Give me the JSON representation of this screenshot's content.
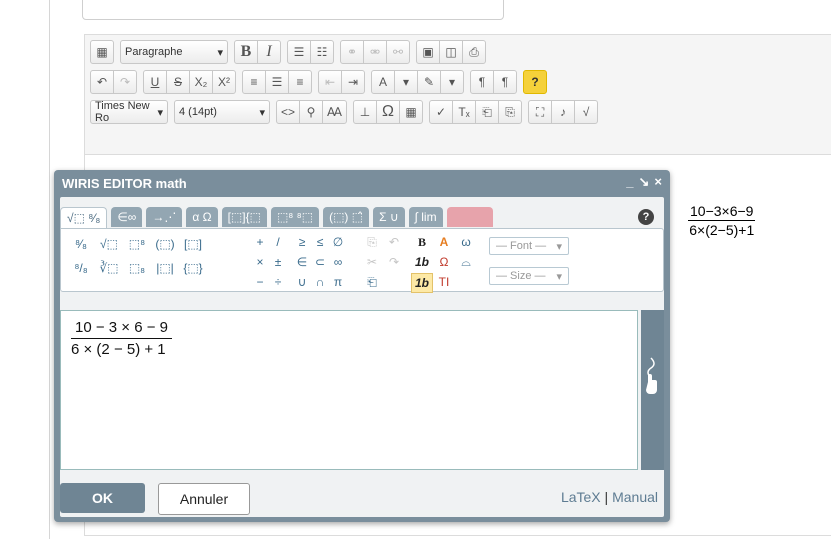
{
  "toolbar": {
    "row1": {
      "format_select": "Paragraphe",
      "bold": "B",
      "italic": "I"
    },
    "row2": {
      "underline": "U",
      "strike": "S",
      "subscript": "X₂",
      "superscript": "X²",
      "help": "?"
    },
    "row3": {
      "font_select": "Times New Ro",
      "size_select": "4 (14pt)",
      "code": "<>",
      "omega": "Ω"
    }
  },
  "preview": {
    "numerator": "10−3×6−9",
    "denominator": "6×(2−5)+1"
  },
  "dialog": {
    "title": "WIRIS EDITOR math",
    "controls": [
      "_",
      "↘",
      "×"
    ],
    "tabs": [
      "√⬚ ⁸⁄₈",
      "∈∞",
      "→⋰",
      "α Ω",
      "[⬚]{⬚",
      "⬚⁸ ⁸⬚",
      "(⬚) ⬚̂",
      "Σ ∪",
      "∫ lim",
      ""
    ],
    "help": "?",
    "palette": {
      "col1": [
        "⁸⁄₈",
        "⁸/₈"
      ],
      "col2": [
        "√⬚",
        "∛⬚"
      ],
      "col3": [
        "⬚⁸",
        "⬚₈"
      ],
      "col4": [
        "(⬚)",
        "|⬚|"
      ],
      "col5": [
        "[⬚]",
        "{⬚}"
      ],
      "ops": [
        "+",
        "/",
        "≥",
        "≤",
        "∅",
        "×",
        "±",
        "∈",
        "⊂",
        "∞",
        "−",
        "÷",
        "∪",
        "∩",
        "π"
      ],
      "font_select": "— Font —",
      "size_select": "— Size —",
      "style_b": "B",
      "style_1b": "1b",
      "style_1b_sel": "1b",
      "style_T": "TI"
    },
    "formula": {
      "numerator": "10 − 3 × 6 − 9",
      "denominator": "6 × (2 − 5) + 1"
    },
    "ok_label": "OK",
    "cancel_label": "Annuler",
    "latex_label": "LaTeX",
    "separator": "|",
    "manual_label": "Manual"
  },
  "colors": {
    "dialog_frame": "#7a8e9c",
    "tab": "#93a6b2",
    "accent": "#4a6a80"
  }
}
